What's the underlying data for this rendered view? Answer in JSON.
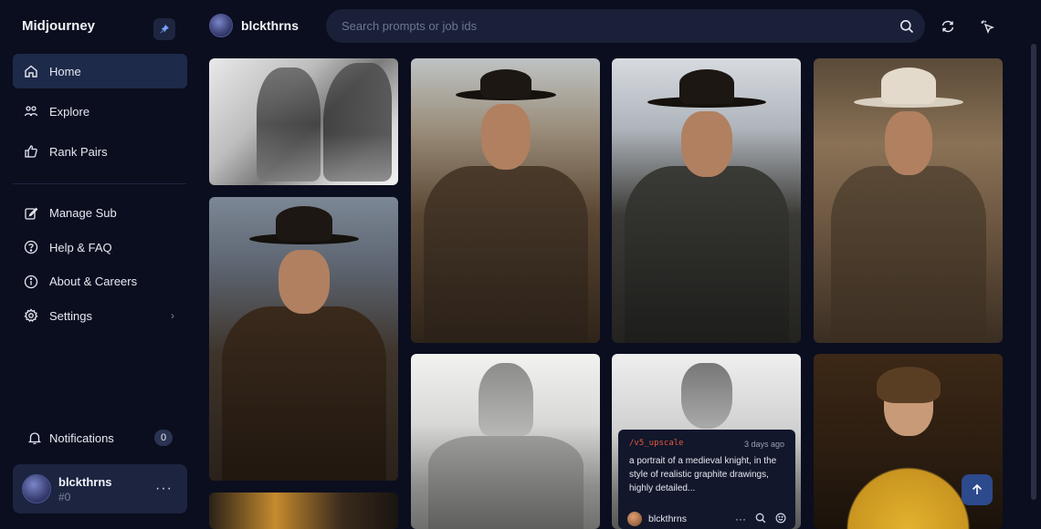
{
  "app": {
    "brand": "Midjourney"
  },
  "sidebar": {
    "primary": [
      {
        "label": "Home",
        "icon": "home-icon",
        "active": true
      },
      {
        "label": "Explore",
        "icon": "explore-icon",
        "active": false
      },
      {
        "label": "Rank Pairs",
        "icon": "thumbs-up-icon",
        "active": false
      }
    ],
    "secondary": [
      {
        "label": "Manage Sub",
        "icon": "edit-icon"
      },
      {
        "label": "Help & FAQ",
        "icon": "help-icon"
      },
      {
        "label": "About & Careers",
        "icon": "info-icon"
      },
      {
        "label": "Settings",
        "icon": "gear-icon",
        "chevron": "›"
      }
    ],
    "notifications": {
      "label": "Notifications",
      "count": "0"
    },
    "user": {
      "name": "blckthrns",
      "tag": "#0",
      "more": "···"
    }
  },
  "topbar": {
    "username": "blckthrns",
    "search_placeholder": "Search prompts or job ids"
  },
  "gallery": {
    "overlay": {
      "command": "/v5_upscale",
      "time": "3 days ago",
      "prompt": "a portrait of a medieval knight, in the style of realistic graphite drawings, highly detailed...",
      "author": "blckthrns",
      "more": "···"
    }
  },
  "colors": {
    "background": "#0b0e1f",
    "active_nav": "#1d2a4a",
    "search_bg": "#1a2038",
    "command_accent": "#e35a3a",
    "fab": "#2c4a8c"
  }
}
